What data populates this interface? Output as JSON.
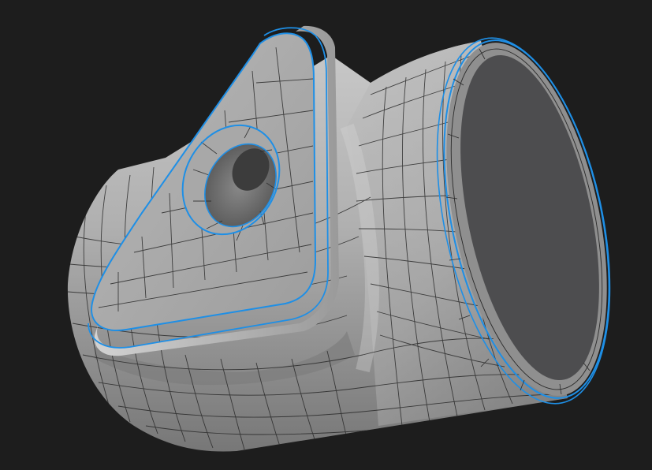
{
  "scene": {
    "kind": "3d-viewport-render",
    "subject": "subdivision-mesh-bracket",
    "colors": {
      "background": "#1d1d1d",
      "surface_light": "#c4c4c4",
      "surface_mid": "#a0a0a0",
      "surface_dark": "#6e6e6e",
      "cap_face": "#4d4d4f",
      "wire": "#2a2a2a",
      "selected_edge": "#1e8fe6"
    }
  }
}
